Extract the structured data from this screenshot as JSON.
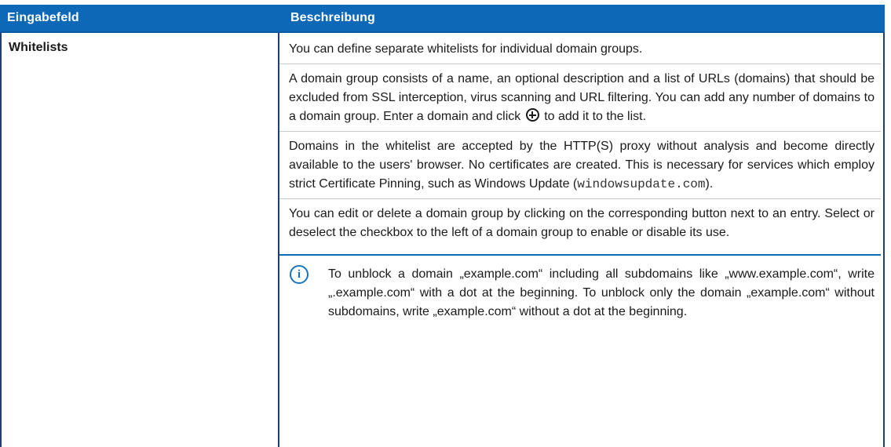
{
  "header": {
    "col1": "Eingabefeld",
    "col2": "Beschreibung"
  },
  "row": {
    "field": "Whitelists",
    "p1": "You can define separate whitelists for individual domain groups.",
    "p2_before": "A domain group consists of a name, an optional description and a list of URLs (domains) that should be excluded from SSL interception, virus scanning and URL filtering. You can add any number of domains to a domain group. Enter a domain and click",
    "p2_after": "to add it to the list.",
    "p3_before": "Domains in the whitelist are accepted by the HTTP(S) proxy without analysis and become directly available to the users' browser. No certificates are created. This is necessary for services which employ strict Certificate Pinning, such as Windows Update (",
    "p3_code": "windowsupdate.com",
    "p3_after": ").",
    "p4": "You can edit or delete a domain group by clicking on the corresponding button next to an entry. Select or deselect the checkbox to the left of a domain group to enable or disable its use.",
    "note_icon_glyph": "i",
    "note": "To unblock a domain „example.com“ including all subdomains like „www.example.com“, write „.example.com“ with a dot at the beginning. To unblock only the domain „example.com“ without subdomains, write „example.com“ without a dot at the beginning."
  },
  "icons": {
    "plus": "plus-circle-icon",
    "info": "info-icon"
  },
  "colors": {
    "header_bg": "#0e68b8",
    "border": "#1d3f73",
    "note_accent": "#1a74bd"
  }
}
